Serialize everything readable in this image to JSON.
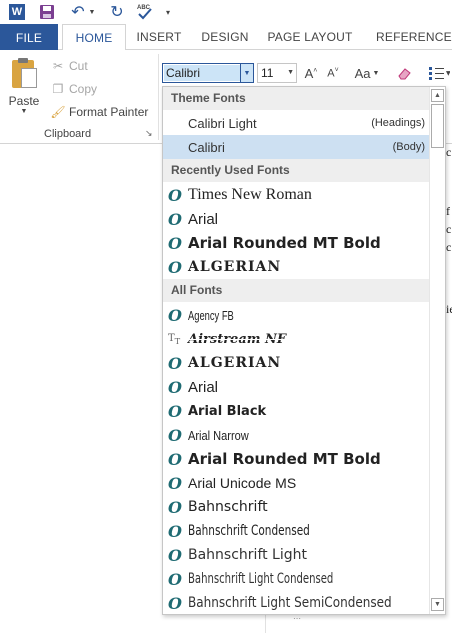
{
  "qat": {
    "app_icon_letter": "W",
    "spelling_icon_text": "ABC"
  },
  "tabs": [
    {
      "label": "FILE"
    },
    {
      "label": "HOME"
    },
    {
      "label": "INSERT"
    },
    {
      "label": "DESIGN"
    },
    {
      "label": "PAGE LAYOUT"
    },
    {
      "label": "REFERENCES"
    }
  ],
  "clipboard": {
    "paste_label": "Paste",
    "cut_label": "Cut",
    "copy_label": "Copy",
    "format_painter_label": "Format Painter",
    "group_label": "Clipboard"
  },
  "font": {
    "name_value": "Calibri",
    "size_value": "11",
    "change_case_label": "Aa"
  },
  "dropdown": {
    "sections": {
      "theme": "Theme Fonts",
      "recent": "Recently Used Fonts",
      "all": "All Fonts"
    },
    "theme_fonts": [
      {
        "name": "Calibri Light",
        "role": "(Headings)",
        "selected": false
      },
      {
        "name": "Calibri",
        "role": "(Body)",
        "selected": true
      }
    ],
    "recent_fonts": [
      {
        "name": "Times New Roman",
        "icon": "opentype-icon"
      },
      {
        "name": "Arial",
        "icon": "opentype-icon"
      },
      {
        "name": "Arial Rounded MT Bold",
        "icon": "opentype-icon"
      },
      {
        "name": "ALGERIAN",
        "icon": "opentype-icon"
      }
    ],
    "all_fonts": [
      {
        "name": "Agency FB",
        "icon": "opentype-icon"
      },
      {
        "name": "Airstream NF",
        "icon": "truetype-icon"
      },
      {
        "name": "ALGERIAN",
        "icon": "opentype-icon"
      },
      {
        "name": "Arial",
        "icon": "opentype-icon"
      },
      {
        "name": "Arial Black",
        "icon": "opentype-icon"
      },
      {
        "name": "Arial Narrow",
        "icon": "opentype-icon"
      },
      {
        "name": "Arial Rounded MT Bold",
        "icon": "opentype-icon"
      },
      {
        "name": "Arial Unicode MS",
        "icon": "opentype-icon"
      },
      {
        "name": "Bahnschrift",
        "icon": "opentype-icon"
      },
      {
        "name": "Bahnschrift Condensed",
        "icon": "opentype-icon"
      },
      {
        "name": "Bahnschrift Light",
        "icon": "opentype-icon"
      },
      {
        "name": "Bahnschrift Light Condensed",
        "icon": "opentype-icon"
      },
      {
        "name": "Bahnschrift Light SemiCondensed",
        "icon": "opentype-icon"
      }
    ]
  },
  "document": {
    "fragments": [
      "c",
      "f",
      "c",
      "c",
      "ie"
    ]
  },
  "colors": {
    "accent": "#2b579a",
    "selected_row": "#cde0f2",
    "section_header_bg": "#eeeeee",
    "font_type_icon": "#1f6b73"
  }
}
